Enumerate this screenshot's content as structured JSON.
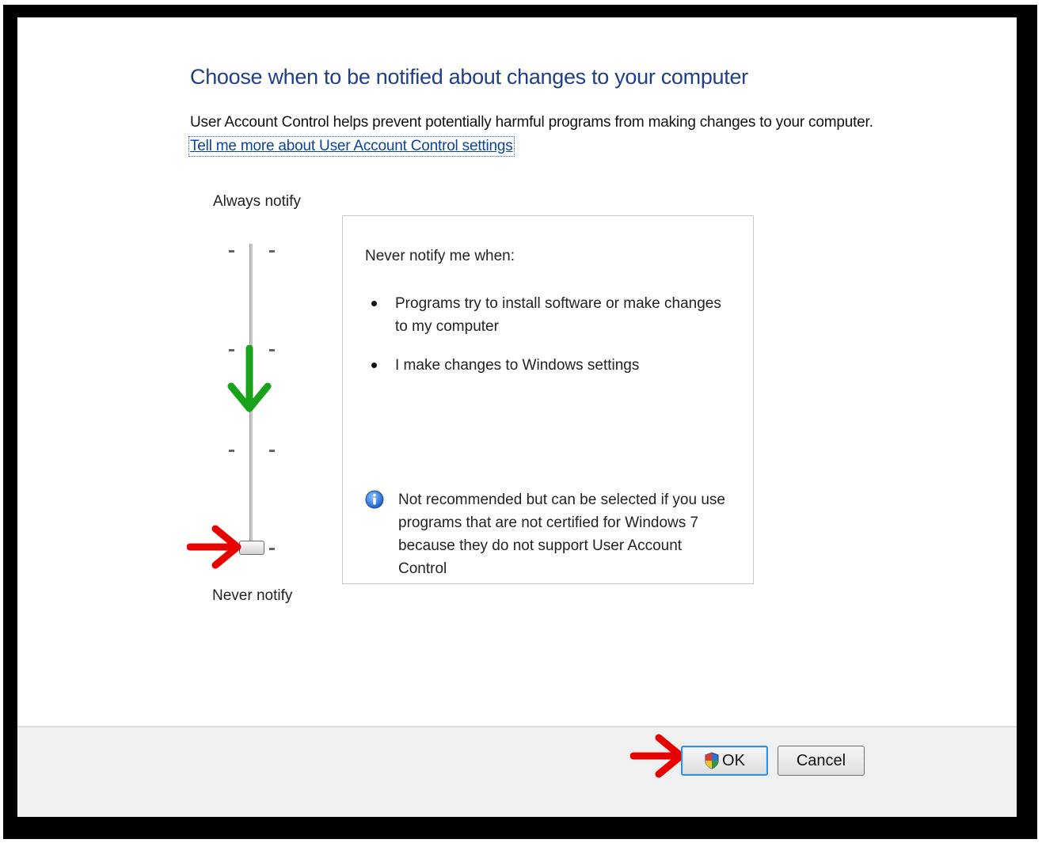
{
  "header": {
    "title": "Choose when to be notified about changes to your computer",
    "description": "User Account Control helps prevent potentially harmful programs from making changes to your computer.",
    "help_link": "Tell me more about User Account Control settings"
  },
  "slider": {
    "top_label": "Always notify",
    "bottom_label": "Never notify",
    "levels": 4,
    "selected_level": 1
  },
  "panel": {
    "heading": "Never notify me when:",
    "bullets": [
      "Programs try to install software or make changes to my computer",
      "I make changes to Windows settings"
    ],
    "note": "Not recommended but can be selected if you use programs that are not certified for Windows 7 because they do not support User Account Control",
    "note_icon": "info-icon"
  },
  "footer": {
    "ok_label": "OK",
    "cancel_label": "Cancel",
    "ok_icon": "shield-icon"
  },
  "annotations": {
    "arrow_down_color": "#1aa31a",
    "arrow_right_color": "#e60000"
  }
}
